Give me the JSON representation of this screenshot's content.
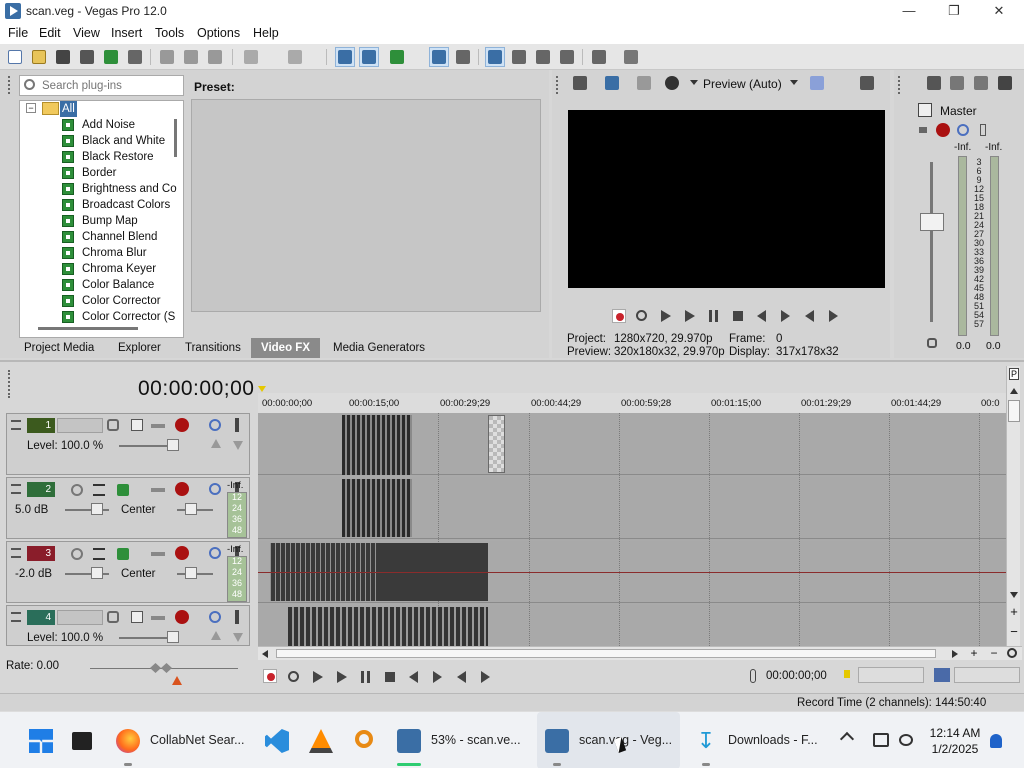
{
  "window": {
    "title": "scan.veg - Vegas Pro 12.0",
    "accent": "#3a6ea5"
  },
  "menu": [
    "File",
    "Edit",
    "View",
    "Insert",
    "Tools",
    "Options",
    "Help"
  ],
  "plugins": {
    "search_placeholder": "Search plug-ins",
    "root": "All",
    "items": [
      "Add Noise",
      "Black and White",
      "Black Restore",
      "Border",
      "Brightness and Co",
      "Broadcast Colors",
      "Bump Map",
      "Channel Blend",
      "Chroma Blur",
      "Chroma Keyer",
      "Color Balance",
      "Color Corrector",
      "Color Corrector (S"
    ]
  },
  "preset_label": "Preset:",
  "tabs": [
    "Project Media",
    "Explorer",
    "Transitions",
    "Video FX",
    "Media Generators"
  ],
  "active_tab": "Video FX",
  "preview": {
    "mode": "Preview (Auto)",
    "project_label": "Project:",
    "project_value": "1280x720, 29.970p",
    "preview_label": "Preview:",
    "preview_value": "320x180x32, 29.970p",
    "frame_label": "Frame:",
    "frame_value": "0",
    "display_label": "Display:",
    "display_value": "317x178x32"
  },
  "master": {
    "label": "Master",
    "inf_left": "-Inf.",
    "inf_right": "-Inf.",
    "scale": [
      "3",
      "6",
      "9",
      "12",
      "15",
      "18",
      "21",
      "24",
      "27",
      "30",
      "33",
      "36",
      "39",
      "42",
      "45",
      "48",
      "51",
      "54",
      "57"
    ],
    "bottom_left": "0.0",
    "bottom_right": "0.0"
  },
  "timeline": {
    "timecode": "00:00:00;00",
    "ruler": [
      "00:00:00;00",
      "00:00:15;00",
      "00:00:29;29",
      "00:00:44;29",
      "00:00:59;28",
      "00:01:15;00",
      "00:01:29;29",
      "00:01:44;29",
      "00:0"
    ]
  },
  "tracks": [
    {
      "num": "1",
      "kind": "video",
      "text": "Level: 100.0 %",
      "color": "#3c5a1e"
    },
    {
      "num": "2",
      "kind": "audio",
      "text": "5.0 dB",
      "pan": "Center",
      "inf": "-Inf.",
      "meter": [
        "12",
        "24",
        "36",
        "48"
      ],
      "color": "#2f6e3a"
    },
    {
      "num": "3",
      "kind": "audio",
      "text": "-2.0 dB",
      "pan": "Center",
      "inf": "-Inf.",
      "meter": [
        "12",
        "24",
        "36",
        "48"
      ],
      "color": "#8a1d2a"
    },
    {
      "num": "4",
      "kind": "video",
      "text": "Level: 100.0 %",
      "color": "#2a6e5a"
    }
  ],
  "rate": "Rate: 0.00",
  "transport_time": "00:00:00;00",
  "status": "Record Time (2 channels): 144:50:40",
  "taskbar": {
    "items": [
      "CollabNet Sear...",
      "53% - scan.ve...",
      "scan.veg - Veg...",
      "Downloads - F..."
    ],
    "time": "12:14 AM",
    "date": "1/2/2025"
  }
}
